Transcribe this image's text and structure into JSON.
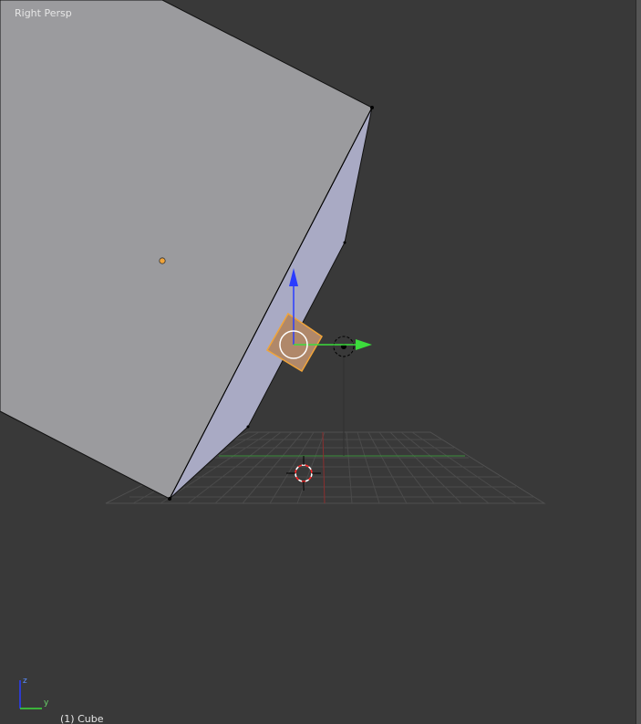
{
  "viewport": {
    "view_label": "Right Persp",
    "object_label": "(1) Cube"
  },
  "axes": {
    "z_label": "z",
    "y_label": "y"
  },
  "colors": {
    "background": "#393939",
    "cube_face": "#9b9b9e",
    "cube_side": "#a9aac4",
    "selection": "#f0a43a",
    "axis_z": "#2a3cff",
    "axis_y": "#3cdc3c",
    "grid": "#4a4a4a"
  },
  "icons": [
    "3d-cursor-icon",
    "light-lamp-icon",
    "camera-icon",
    "transform-manipulator-icon",
    "axis-gizmo-icon"
  ]
}
